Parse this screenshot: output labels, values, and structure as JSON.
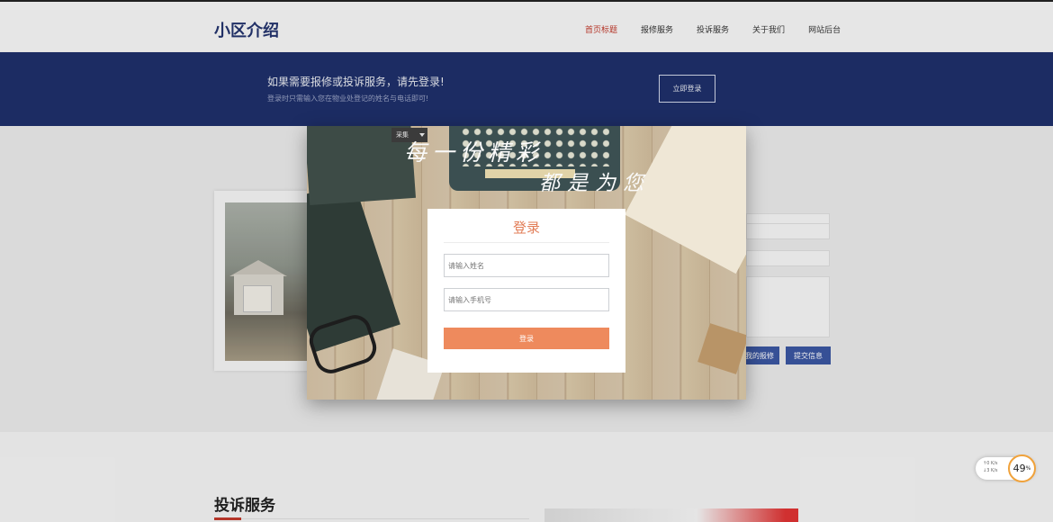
{
  "header": {
    "brand": "小区介绍",
    "nav": [
      "首页标题",
      "报修服务",
      "投诉服务",
      "关于我们",
      "网站后台"
    ]
  },
  "banner": {
    "title": "如果需要报修或投诉服务，请先登录!",
    "subtitle": "登录时只需输入您在物业处登记的姓名与电话即可!",
    "button": "立即登录"
  },
  "section": {
    "btn_my_repairs": "我的报修",
    "btn_submit": "提交信息"
  },
  "lower": {
    "title": "投诉服务"
  },
  "modal": {
    "tag": "采集",
    "calligraphy_line1": "每一份精彩",
    "calligraphy_line2": "都是为您",
    "login_title": "登录",
    "name_placeholder": "请输入姓名",
    "phone_placeholder": "请输入手机号",
    "login_button": "登录"
  },
  "speed_widget": {
    "up": "↑0 K/s",
    "down": "↓3 K/s",
    "percent": "49",
    "percent_unit": "%"
  },
  "colors": {
    "banner": "#1e2f6a",
    "accent": "#ee8a5d",
    "nav_active": "#c0392b"
  }
}
